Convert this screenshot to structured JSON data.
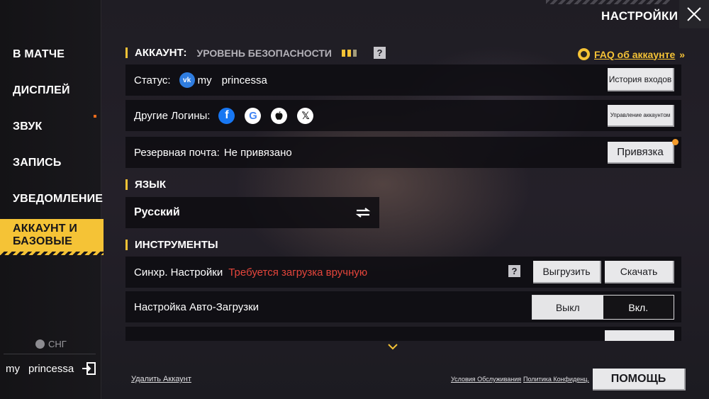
{
  "header": {
    "title": "НАСТРОЙКИ",
    "close_icon": "close-icon"
  },
  "sidebar": {
    "items": [
      {
        "label": "В МАТЧЕ"
      },
      {
        "label": "ДИСПЛЕЙ"
      },
      {
        "label": "ЗВУК"
      },
      {
        "label": "ЗАПИСЬ"
      },
      {
        "label": "УВЕДОМЛЕНИЕ"
      },
      {
        "label": "АККАУНТ И БАЗОВЫЕ",
        "active": true
      }
    ],
    "region": "СНГ",
    "user_first": "my",
    "user_second": "princessa"
  },
  "account": {
    "section_title": "АККАУНТ:",
    "security_label": "УРОВЕНЬ БЕЗОПАСНОСТИ",
    "security_level": 3,
    "faq_label": "FAQ об аккаунте",
    "status_label": "Статус:",
    "status_name_first": "my",
    "status_name_second": "princessa",
    "login_history_button": "История входов",
    "other_logins_label": "Другие Логины:",
    "manage_account_button": "Управление аккаунтом",
    "backup_email_label": "Резервная почта:",
    "backup_email_value": "Не привязано",
    "bind_button": "Привязка"
  },
  "language": {
    "section_title": "ЯЗЫК",
    "current": "Русский"
  },
  "tools": {
    "section_title": "ИНСТРУМЕНТЫ",
    "sync_label": "Синхр. Настройки",
    "sync_warning": "Требуется загрузка вручную",
    "upload_button": "Выгрузить",
    "download_button": "Скачать",
    "auto_download_label": "Настройка Авто-Загрузки",
    "toggle_off": "Выкл",
    "toggle_on": "Вкл.",
    "toggle_state": "on"
  },
  "footer": {
    "delete_account": "Удалить Аккаунт",
    "terms": "Условия Обслуживания",
    "privacy": "Политика Конфиденц.",
    "help_button": "ПОМОЩЬ"
  },
  "colors": {
    "accent": "#f5c336",
    "warning": "#e4453b",
    "vk": "#2f7de0",
    "facebook": "#1877f2"
  }
}
